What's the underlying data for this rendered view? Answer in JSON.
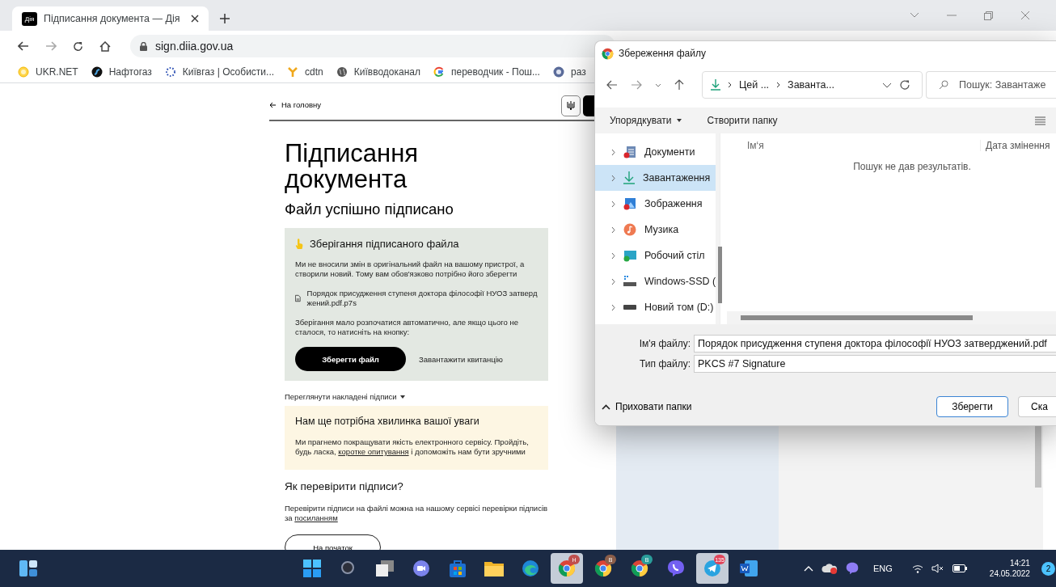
{
  "browser": {
    "tabs": [
      {
        "title": "Підписання документа — Дія",
        "favicon": "Дія",
        "selected": true
      }
    ],
    "url": "sign.diia.gov.ua",
    "bookmarks": [
      {
        "kind": "ukrnet",
        "label": "UKR.NET"
      },
      {
        "kind": "naftogaz",
        "label": "Нафтогаз"
      },
      {
        "kind": "kyivgaz",
        "label": "Київгаз | Особисти..."
      },
      {
        "kind": "cdtn",
        "label": "cdtn"
      },
      {
        "kind": "globe",
        "label": "Київводоканал"
      },
      {
        "kind": "google",
        "label": "переводчик - Пош..."
      },
      {
        "kind": "round",
        "label": "раз"
      }
    ]
  },
  "page": {
    "back_link": "На головну",
    "title": "Підписання документа",
    "subtitle": "Файл успішно підписано",
    "save_card": {
      "title": "Зберігання підписаного файла",
      "text": "Ми не вносили змін в оригінальний файл на вашому пристрої, а створили новий. Тому вам обов'язково потрібно його зберегти",
      "file_name": "Порядок присудження ступеня доктора філософії НУОЗ затверджений.pdf.p7s",
      "hint": "Зберігання мало розпочатися автоматично, але якщо цього не сталося, то натисніть на кнопку:",
      "save_button": "Зберегти файл",
      "receipt_link": "Завантажити квитанцію"
    },
    "signatures_toggle": {
      "label": "Переглянути накладені підписи",
      "expanded": false
    },
    "survey": {
      "title": "Нам ще потрібна хвилинка вашої уваги",
      "text_before": "Ми прагнемо покращувати якість електронного сервісу. Пройдіть, будь ласка,",
      "link": "коротке опитування",
      "text_after": "і допоможіть нам бути зручними"
    },
    "verify": {
      "title": "Як перевірити підписи?",
      "text": "Перевірити підписи на файлі можна на нашому сервісі перевірки підписів за",
      "link": "посиланням"
    },
    "start_button": "На початок"
  },
  "dialog": {
    "title": "Збереження файлу",
    "path": [
      "Цей ...",
      "Заванта..."
    ],
    "search_placeholder": "Пошук: Завантаже",
    "organize": "Упорядкувати",
    "new_folder": "Створити папку",
    "folders": [
      {
        "kind": "documents",
        "label": "Документи",
        "selected": false
      },
      {
        "kind": "downloads",
        "label": "Завантаження",
        "selected": true
      },
      {
        "kind": "pictures",
        "label": "Зображення",
        "selected": false
      },
      {
        "kind": "music",
        "label": "Музика",
        "selected": false
      },
      {
        "kind": "desktop",
        "label": "Робочий стіл",
        "selected": false
      },
      {
        "kind": "ssd",
        "label": "Windows-SSD (",
        "selected": false
      },
      {
        "kind": "drive",
        "label": "Новий том (D:)",
        "selected": false
      }
    ],
    "columns": [
      "Ім‘я",
      "Дата змінення"
    ],
    "empty_message": "Пошук не дав результатів.",
    "file_name_label": "Ім'я файлу:",
    "file_name": "Порядок присудження ступеня доктора філософії НУОЗ затверджений.pdf",
    "file_type_label": "Тип файлу:",
    "file_type": "PKCS #7 Signature",
    "hide_folders": "Приховати папки",
    "save_button": "Зберегти",
    "cancel_button": "Ска"
  },
  "taskbar": {
    "apps": [
      {
        "kind": "start",
        "selected": false
      },
      {
        "kind": "search",
        "selected": false
      },
      {
        "kind": "taskview",
        "selected": false
      },
      {
        "kind": "chat",
        "selected": false
      },
      {
        "kind": "store",
        "selected": false
      },
      {
        "kind": "explorer",
        "selected": false
      },
      {
        "kind": "edge",
        "selected": false
      },
      {
        "kind": "chrome",
        "selected": true,
        "badge": "H",
        "color": "#c0504d"
      },
      {
        "kind": "chrome",
        "selected": false,
        "badge": "B",
        "color": "#8b5e4a"
      },
      {
        "kind": "chrome",
        "selected": false,
        "badge": "B",
        "color": "#2a9d9a"
      },
      {
        "kind": "viber",
        "selected": false
      },
      {
        "kind": "telegram",
        "selected": true,
        "badge": "135",
        "color": "#e0445a"
      },
      {
        "kind": "word",
        "selected": false
      }
    ],
    "language": "ENG",
    "time": "14:21",
    "date": "24.05.2022",
    "notifications": "2"
  }
}
